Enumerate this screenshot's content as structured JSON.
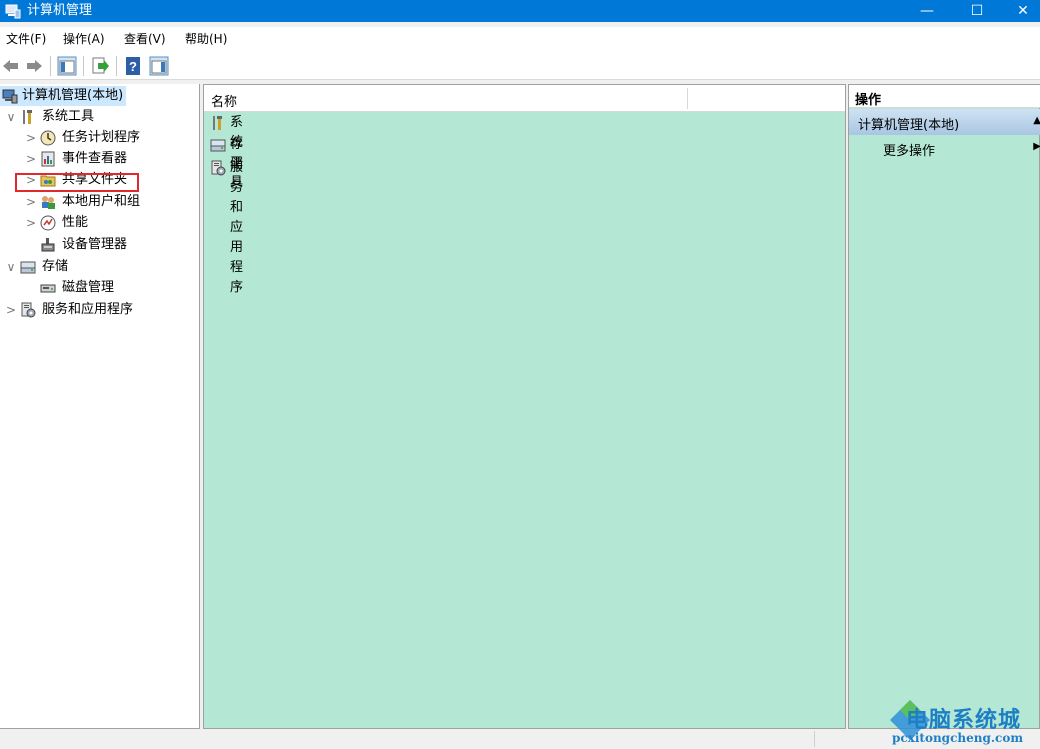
{
  "window": {
    "title": "计算机管理",
    "controls": {
      "minimize": "—",
      "maximize": "☐",
      "close": "✕"
    }
  },
  "menubar": {
    "items": [
      "文件(F)",
      "操作(A)",
      "查看(V)",
      "帮助(H)"
    ]
  },
  "toolbar": {
    "icons": [
      "back-arrow-icon",
      "forward-arrow-icon",
      "show-hide-tree-icon",
      "export-list-icon",
      "help-icon",
      "show-hide-action-pane-icon"
    ]
  },
  "tree": {
    "root": "计算机管理(本地)",
    "items": [
      {
        "label": "系统工具",
        "chevron": "∨",
        "icon": "tools-icon"
      },
      {
        "label": "任务计划程序",
        "chevron": ">",
        "icon": "clock-icon"
      },
      {
        "label": "事件查看器",
        "chevron": ">",
        "icon": "event-viewer-icon"
      },
      {
        "label": "共享文件夹",
        "chevron": ">",
        "icon": "shared-folder-icon"
      },
      {
        "label": "本地用户和组",
        "chevron": ">",
        "icon": "users-icon"
      },
      {
        "label": "性能",
        "chevron": ">",
        "icon": "performance-icon"
      },
      {
        "label": "设备管理器",
        "chevron": "",
        "icon": "device-manager-icon"
      },
      {
        "label": "存储",
        "chevron": "∨",
        "icon": "storage-icon"
      },
      {
        "label": "磁盘管理",
        "chevron": "",
        "icon": "disk-icon"
      },
      {
        "label": "服务和应用程序",
        "chevron": ">",
        "icon": "services-icon"
      }
    ]
  },
  "content": {
    "column_name": "名称",
    "rows": [
      {
        "label": "系统工具",
        "icon": "tools-icon"
      },
      {
        "label": "存储",
        "icon": "storage-icon"
      },
      {
        "label": "服务和应用程序",
        "icon": "services-icon"
      }
    ]
  },
  "actions": {
    "header": "操作",
    "section": "计算机管理(本地)",
    "section_arrow": "▲",
    "items": [
      {
        "label": "更多操作",
        "arrow": "▶"
      }
    ]
  },
  "watermark": {
    "text_cn": "电脑系统城",
    "text_en": "pcxitongcheng.com"
  },
  "colors": {
    "titlebar": "#0078d7",
    "pane_bg": "#b4e8d4",
    "highlight_box": "#e0282d",
    "selection": "#cce8ff"
  }
}
